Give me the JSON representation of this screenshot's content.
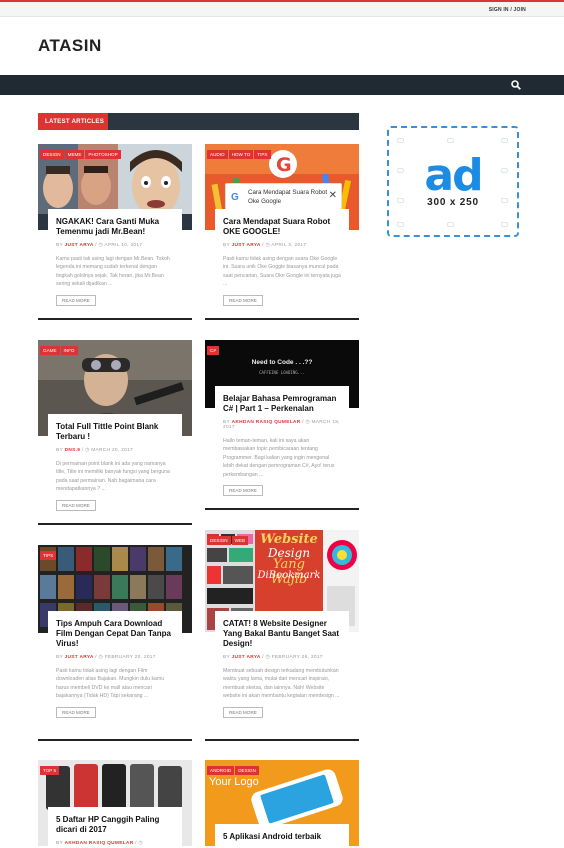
{
  "topbar": {
    "signin_label": "SIGN IN / JOIN"
  },
  "logo": "ATASIN",
  "section": {
    "title": "LATEST ARTICLES"
  },
  "ad": {
    "text": "ad",
    "size": "300 x 250"
  },
  "articles": [
    {
      "tags": [
        "DESIGN",
        "MEME",
        "PHOTOSHOP"
      ],
      "title": "NGAKAK! Cara Ganti Muka Temenmu jadi Mr.Bean!",
      "by": "BY",
      "author": "JUST ARYA",
      "date": "APRIL 10, 2017",
      "excerpt": "Kamu pasti tak asing lagi dengan Mr.Bean. Tokoh legenda ini memang sudah terkenal dengan tingkah gokilnya sejak. Tak heran, jika Mr.Bean sering sekali dijadikan ...",
      "readmore": "READ MORE"
    },
    {
      "tags": [
        "AUDIO",
        "HOW TO",
        "TIPS"
      ],
      "title": "Cara Mendapat Suara Robot OKE GOOGLE!",
      "by": "BY",
      "author": "JUST ARYA",
      "date": "APRIL 3, 2017",
      "excerpt": "Pasti kamu tidak asing dengan suara Oke Google ini. Suara unik Oke Goggle biasanya muncul pada saat pencarian. Suara Oke Google ini ternyata juga ...",
      "readmore": "READ MORE",
      "popup": "Cara Mendapat Suara Robot Oke Google"
    },
    {
      "tags": [
        "GAME",
        "INFO"
      ],
      "title": "Total Full Tittle Point Blank Terbaru !",
      "by": "BY",
      "author": "DNS.9",
      "date": "MARCH 20, 2017",
      "excerpt": "Di permainan point blank ini ada yang namanya title, Title ini memiliki banyak fungsi yang berguna pada saat permainan. Nah bagaimana cara mendapatkannya ? ...",
      "readmore": "READ MORE"
    },
    {
      "tags": [
        "C#"
      ],
      "title": "Belajar Bahasa Pemrograman C# | Part 1 – Perkenalan",
      "by": "BY",
      "author": "AKHDAN RASIQ QUMELAR",
      "date": "MARCH 19, 2017",
      "excerpt": "Hallo teman-teman, kali ini saya akan membawakan topic pembicaraan tentang Programmer. Bagi kalian yang ingin mengenal lebih dekat dengan pemrograman C#, Ayo! terus perkembangan ...",
      "readmore": "READ MORE",
      "img_line1": "Need to Code . . .??",
      "img_line2": "CAFFEINE LOADING..."
    },
    {
      "tags": [
        "TIPS"
      ],
      "title": "Tips Ampuh Cara Download Film Dengan Cepat Dan Tanpa Virus!",
      "by": "BY",
      "author": "JUST ARYA",
      "date": "FEBRUARY 20, 2017",
      "excerpt": "Pasti kamu tidak asing lagi dengan Film downloaden alias Bajakan. Mungkin dulu kamu harus membeli DVD ke mall atau mencari bajakannya (Tidak HD) Tapi sekarang ...",
      "readmore": "READ MORE"
    },
    {
      "tags": [
        "DESIGN",
        "WEB"
      ],
      "title": "CATAT! 8 Website Designer Yang Bakal Bantu Banget Saat Design!",
      "by": "BY",
      "author": "JUST ARYA",
      "date": "FEBRUARY 26, 2017",
      "excerpt": "Membuat sebuah design terkadang membutuhkan waktu yang lama, mulai dari mencari inspirasi, membuat sketsa, dan lainnya. Nah! Website website ini akan membantu kegiatan mendesign ...",
      "readmore": "READ MORE",
      "img_line1": "Website",
      "img_line2": "Design",
      "img_line3": "Yang Wajib",
      "img_line4": "DiBookmark"
    },
    {
      "tags": [
        "TOP 5"
      ],
      "title": "5 Daftar HP Canggih Paling dicari di 2017",
      "by": "BY",
      "author": "AKHDAN RASIQ QUMELAR",
      "date": "",
      "excerpt": "",
      "readmore": ""
    },
    {
      "tags": [
        "ANDROID",
        "DESIGN"
      ],
      "title": "5 Aplikasi Android terbaik",
      "by": "",
      "author": "",
      "date": "",
      "excerpt": "",
      "readmore": "",
      "img_line1": "Your Logo"
    }
  ]
}
